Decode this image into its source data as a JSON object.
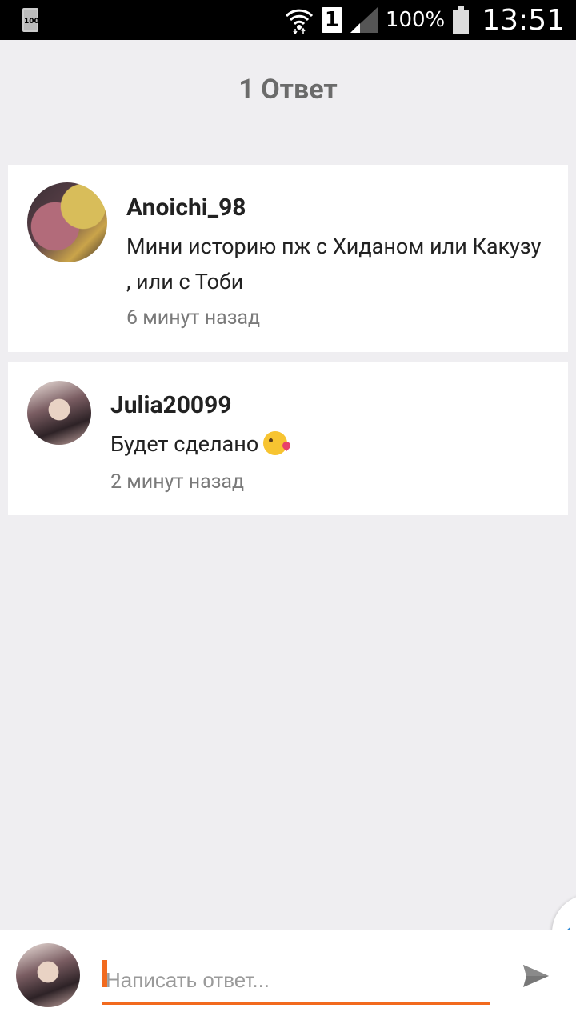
{
  "status_bar": {
    "left_icon_text": "100",
    "sim_slot": "1",
    "battery_percent": "100%",
    "time": "13:51"
  },
  "header": {
    "title": "1 Ответ"
  },
  "comments": [
    {
      "username": "Anoichi_98",
      "message": "Мини историю пж с Хиданом или Какузу , или с Тоби",
      "time": "6 минут назад"
    },
    {
      "username": "Julia20099",
      "message": "Будет сделано",
      "emoji": "kissing-face-emoji",
      "time": "2 минут назад"
    }
  ],
  "reply": {
    "placeholder": "Написать ответ..."
  },
  "colors": {
    "accent": "#f26a1e",
    "background": "#efeef1",
    "handle_accent": "#2f8ad6"
  }
}
